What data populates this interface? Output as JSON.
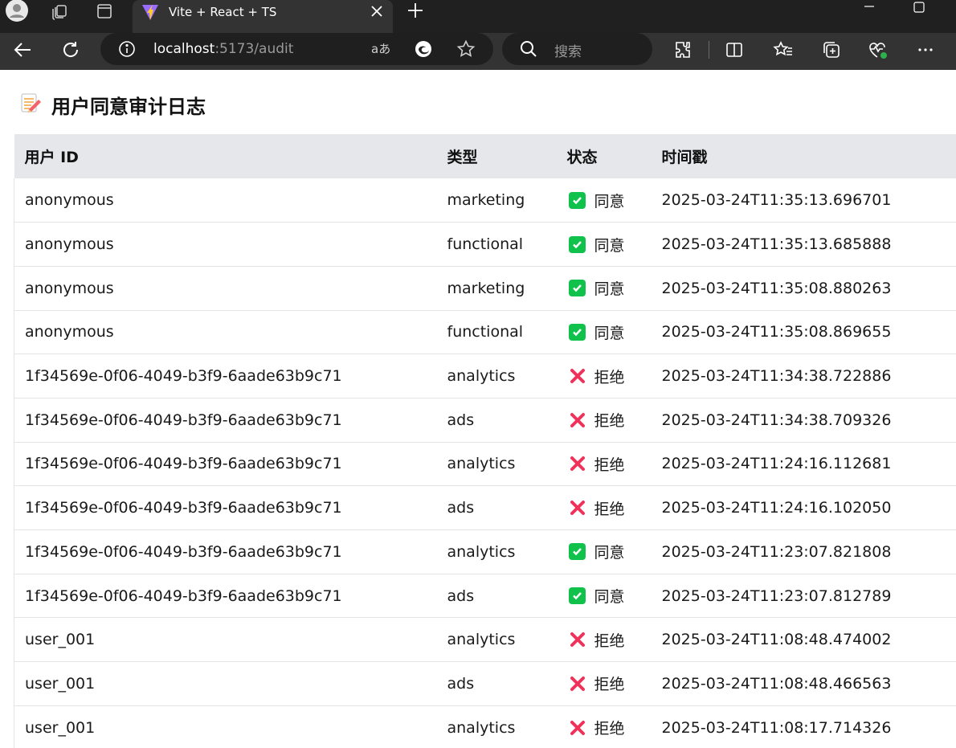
{
  "browser": {
    "tab_title": "Vite + React + TS",
    "url_host": "localhost",
    "url_rest": ":5173/audit",
    "search_placeholder": "搜索",
    "icons": [
      "profile-icon",
      "workspaces-icon",
      "tab-actions-icon",
      "vite-logo-icon",
      "close-icon",
      "new-tab-icon",
      "minimize-icon",
      "maximize-icon",
      "back-icon",
      "refresh-icon",
      "site-info-icon",
      "read-aloud-icon",
      "edge-copilot-icon",
      "favorite-star-icon",
      "search-icon",
      "extensions-icon",
      "split-screen-icon",
      "favorites-icon",
      "collections-icon",
      "browser-essentials-icon",
      "more-icon"
    ]
  },
  "page": {
    "title_icon": "memo-icon",
    "title": "用户同意审计日志"
  },
  "table": {
    "headers": {
      "user": "用户 ID",
      "type": "类型",
      "status": "状态",
      "time": "时间戳"
    },
    "rows": [
      {
        "user": "anonymous",
        "type": "marketing",
        "granted": true,
        "status": "同意",
        "time": "2025-03-24T11:35:13.696701"
      },
      {
        "user": "anonymous",
        "type": "functional",
        "granted": true,
        "status": "同意",
        "time": "2025-03-24T11:35:13.685888"
      },
      {
        "user": "anonymous",
        "type": "marketing",
        "granted": true,
        "status": "同意",
        "time": "2025-03-24T11:35:08.880263"
      },
      {
        "user": "anonymous",
        "type": "functional",
        "granted": true,
        "status": "同意",
        "time": "2025-03-24T11:35:08.869655"
      },
      {
        "user": "1f34569e-0f06-4049-b3f9-6aade63b9c71",
        "type": "analytics",
        "granted": false,
        "status": "拒绝",
        "time": "2025-03-24T11:34:38.722886"
      },
      {
        "user": "1f34569e-0f06-4049-b3f9-6aade63b9c71",
        "type": "ads",
        "granted": false,
        "status": "拒绝",
        "time": "2025-03-24T11:34:38.709326"
      },
      {
        "user": "1f34569e-0f06-4049-b3f9-6aade63b9c71",
        "type": "analytics",
        "granted": false,
        "status": "拒绝",
        "time": "2025-03-24T11:24:16.112681"
      },
      {
        "user": "1f34569e-0f06-4049-b3f9-6aade63b9c71",
        "type": "ads",
        "granted": false,
        "status": "拒绝",
        "time": "2025-03-24T11:24:16.102050"
      },
      {
        "user": "1f34569e-0f06-4049-b3f9-6aade63b9c71",
        "type": "analytics",
        "granted": true,
        "status": "同意",
        "time": "2025-03-24T11:23:07.821808"
      },
      {
        "user": "1f34569e-0f06-4049-b3f9-6aade63b9c71",
        "type": "ads",
        "granted": true,
        "status": "同意",
        "time": "2025-03-24T11:23:07.812789"
      },
      {
        "user": "user_001",
        "type": "analytics",
        "granted": false,
        "status": "拒绝",
        "time": "2025-03-24T11:08:48.474002"
      },
      {
        "user": "user_001",
        "type": "ads",
        "granted": false,
        "status": "拒绝",
        "time": "2025-03-24T11:08:48.466563"
      },
      {
        "user": "user_001",
        "type": "analytics",
        "granted": false,
        "status": "拒绝",
        "time": "2025-03-24T11:08:17.714326"
      }
    ]
  },
  "colors": {
    "granted": "#10c24c",
    "denied": "#f0325a",
    "header_bg": "#e5e7eb"
  }
}
